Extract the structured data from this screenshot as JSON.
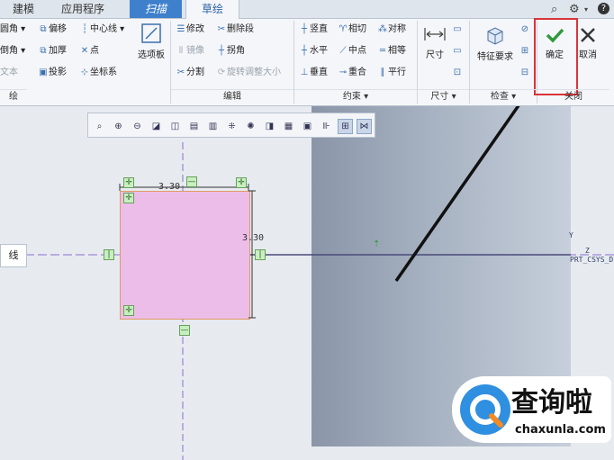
{
  "tabs": [
    "建模",
    "应用程序",
    "扫描",
    "草绘"
  ],
  "ribbon": {
    "col1": [
      "圆角",
      "倒角",
      "文本"
    ],
    "col2": [
      "偏移",
      "加厚",
      "投影"
    ],
    "col3": [
      "中心线",
      "点",
      "坐标系"
    ],
    "palette": "选项板",
    "edit": [
      "修改",
      "镜像",
      "分割"
    ],
    "edit2": [
      "删除段",
      "拐角",
      "旋转调整大小"
    ],
    "cons1": [
      "竖直",
      "水平",
      "垂直"
    ],
    "cons2": [
      "相切",
      "中点",
      "重合"
    ],
    "cons3": [
      "对称",
      "相等",
      "平行"
    ],
    "dimension": "尺寸",
    "feature_req": "特征要求",
    "ok": "确定",
    "cancel": "取消",
    "groups": [
      "绘",
      "编辑",
      "约束",
      "尺寸",
      "检查",
      "关闭"
    ]
  },
  "canvas": {
    "line_label": "线",
    "dim_h": "3.30",
    "dim_v": "3.30",
    "csys_y": "Y",
    "csys_z": "Z",
    "csys_name": "PRT_CSYS_D..."
  },
  "watermark": {
    "title": "查询啦",
    "domain": "chaxunla.com"
  },
  "colors": {
    "sketch_fill": "#ecbde8",
    "sketch_edge": "#e09a63",
    "ok_green": "#2e9a3c",
    "highlight_red": "#d9343a",
    "tab_active": "#3f80cc"
  }
}
